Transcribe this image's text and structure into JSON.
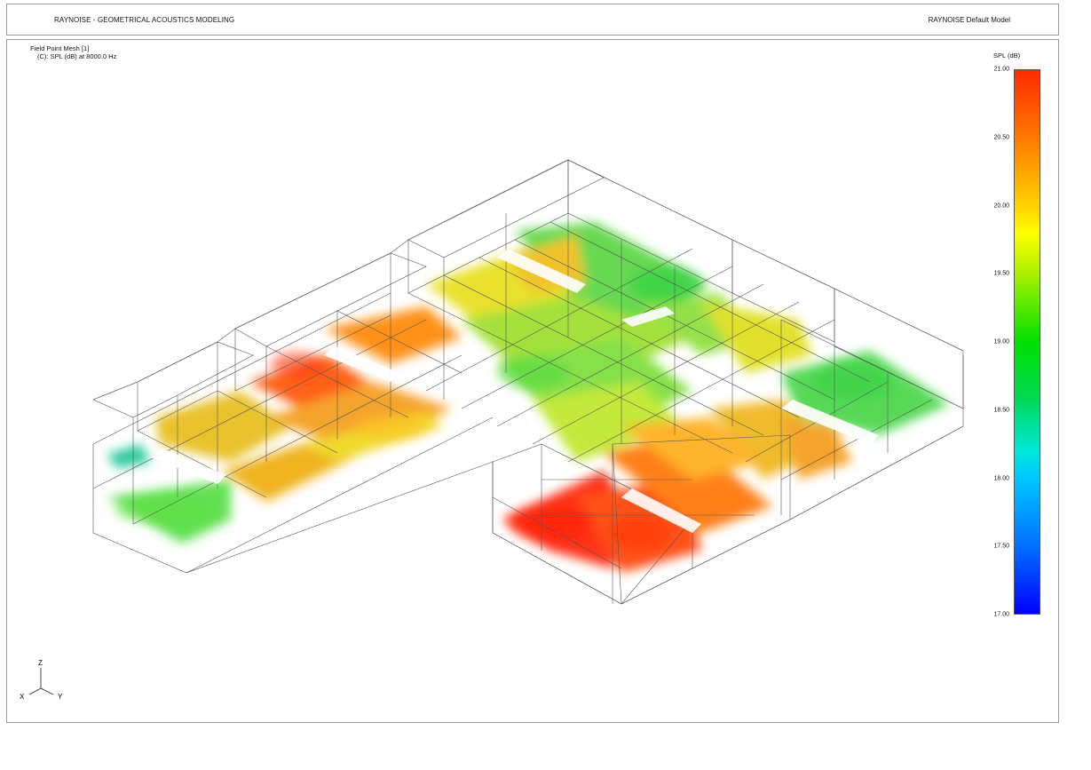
{
  "header": {
    "left_title": "RAYNOISE - GEOMETRICAL ACOUSTICS MODELING",
    "right_title": "RAYNOISE Default Model"
  },
  "info": {
    "line1": "Field Point Mesh [1]",
    "line2": "(C): SPL (dB) at 8000.0 Hz"
  },
  "legend": {
    "title": "SPL (dB)",
    "ticks": [
      "21.00",
      "20.50",
      "20.00",
      "19.50",
      "19.00",
      "18.50",
      "18.00",
      "17.50",
      "17.00"
    ],
    "max_color": "#ff2a00",
    "min_color": "#0000ff"
  },
  "axes": {
    "z": "Z",
    "x": "X",
    "y": "Y"
  }
}
